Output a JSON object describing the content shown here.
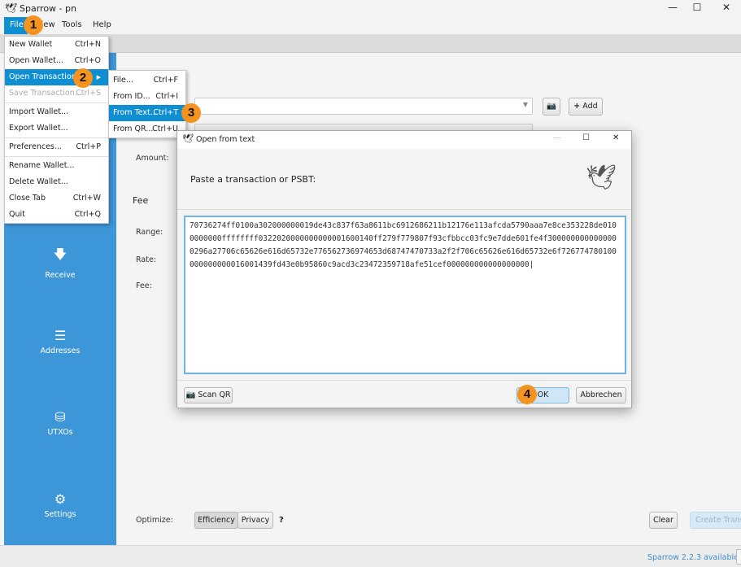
{
  "window": {
    "title": "Sparrow - pn",
    "icon": "sparrow-logo-icon"
  },
  "menubar": [
    "File",
    "View",
    "Tools",
    "Help"
  ],
  "file_menu": [
    {
      "label": "New Wallet",
      "shortcut": "Ctrl+N"
    },
    {
      "label": "Open Wallet...",
      "shortcut": "Ctrl+O"
    },
    {
      "label": "Open Transaction",
      "shortcut": ""
    },
    {
      "label": "Save Transaction...",
      "shortcut": "Ctrl+S"
    },
    {
      "label": "Import Wallet...",
      "shortcut": ""
    },
    {
      "label": "Export Wallet...",
      "shortcut": ""
    },
    {
      "label": "Preferences...",
      "shortcut": "Ctrl+P"
    },
    {
      "label": "Rename Wallet...",
      "shortcut": ""
    },
    {
      "label": "Delete Wallet...",
      "shortcut": ""
    },
    {
      "label": "Close Tab",
      "shortcut": "Ctrl+W"
    },
    {
      "label": "Quit",
      "shortcut": "Ctrl+Q"
    }
  ],
  "submenu": [
    {
      "label": "File...",
      "shortcut": "Ctrl+F"
    },
    {
      "label": "From ID...",
      "shortcut": "Ctrl+I"
    },
    {
      "label": "From Text...",
      "shortcut": "Ctrl+T"
    },
    {
      "label": "From QR...",
      "shortcut": "Ctrl+U"
    }
  ],
  "badges": [
    "1",
    "2",
    "3",
    "4"
  ],
  "sidebar": [
    {
      "label": "Receive",
      "icon": "arrow-down-icon"
    },
    {
      "label": "Addresses",
      "icon": "list-icon"
    },
    {
      "label": "UTXOs",
      "icon": "coins-icon"
    },
    {
      "label": "Settings",
      "icon": "gear-icon"
    }
  ],
  "form": {
    "amount": "Amount:",
    "fee": "Fee",
    "range": "Range:",
    "rate": "Rate:",
    "fee_label": "Fee:",
    "add": "Add",
    "optimize": "Optimize:",
    "efficiency": "Efficiency",
    "privacy": "Privacy",
    "clear": "Clear",
    "create": "Create Transaction"
  },
  "dialog": {
    "title": "Open from text",
    "prompt": "Paste a transaction or PSBT:",
    "text": "70736274ff0100a302000000019de43c837f63a8611bc6912686211b12176e113afcda5790aaa7e8ce353228de0100000000ffffffff0322020000000000001600140ff279f779807f93cfbbcc03fc9e7dde601fe4f3000000000000000296a27706c65626e616d65732e776562736974653d68747470733a2f2f706c65626e616d65732e6f726774780100000000000016001439fd43e0b95860c9acd3c23472359718afe51cef000000000000000000",
    "scan": "Scan QR",
    "ok": "OK",
    "cancel": "Abbrechen"
  },
  "status": {
    "update": "Sparrow 2.2.3 available"
  },
  "colors": {
    "accent": "#0f8fd2",
    "sidebar": "#3d96d8",
    "badge": "#f5931f"
  }
}
